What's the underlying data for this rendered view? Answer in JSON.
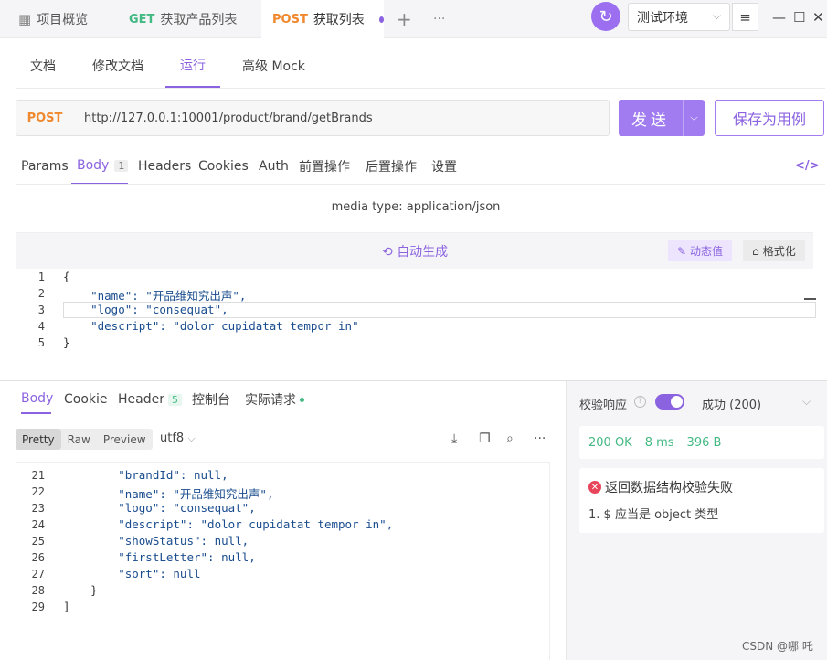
{
  "top_tabs": {
    "overview": "项目概览",
    "get_method": "GET",
    "get_label": "获取产品列表",
    "post_method": "POST",
    "post_label": "获取列表",
    "add": "+",
    "more": "···"
  },
  "env": {
    "name": "测试环境"
  },
  "sub_tabs": [
    "文档",
    "修改文档",
    "运行",
    "高级 Mock"
  ],
  "request": {
    "method": "POST",
    "url": "http://127.0.0.1:10001/product/brand/getBrands",
    "send_label": "发送",
    "save_label": "保存为用例"
  },
  "req_tabs": {
    "params": "Params",
    "body": "Body",
    "body_count": "1",
    "headers": "Headers",
    "cookies": "Cookies",
    "auth": "Auth",
    "pre": "前置操作",
    "post": "后置操作",
    "settings": "设置"
  },
  "media_type": "media type: application/json",
  "editor": {
    "autogen": "自动生成",
    "dynamic": "动态值",
    "format": "格式化",
    "line_numbers": [
      "1",
      "2",
      "3",
      "4",
      "5"
    ],
    "lines": [
      "{",
      "    \"name\": \"开品维知究出声\",",
      "    \"logo\": \"consequat\",",
      "    \"descript\": \"dolor cupidatat tempor in\"",
      "}"
    ]
  },
  "resp_tabs": {
    "body": "Body",
    "cookie": "Cookie",
    "header": "Header",
    "header_count": "5",
    "console": "控制台",
    "actual": "实际请求"
  },
  "resp_view": {
    "pretty": "Pretty",
    "raw": "Raw",
    "preview": "Preview",
    "encoding": "utf8"
  },
  "response_code": {
    "line_numbers": [
      "21",
      "22",
      "23",
      "24",
      "25",
      "26",
      "27",
      "28",
      "29"
    ],
    "lines": [
      "        \"brandId\": null,",
      "        \"name\": \"开品维知究出声\",",
      "        \"logo\": \"consequat\",",
      "        \"descript\": \"dolor cupidatat tempor in\",",
      "        \"showStatus\": null,",
      "        \"firstLetter\": null,",
      "        \"sort\": null",
      "    }",
      "]"
    ]
  },
  "validation": {
    "label": "校验响应",
    "result": "成功 (200)",
    "status": "200 OK",
    "time": "8 ms",
    "size": "396 B",
    "fail_title": "返回数据结构校验失败",
    "fail_item": "1. $ 应当是 object 类型"
  },
  "watermark": "CSDN @哪 吒",
  "colors": {
    "accent": "#8b63e0",
    "post": "#f0882d",
    "get": "#43b983",
    "error": "#e8455a"
  }
}
